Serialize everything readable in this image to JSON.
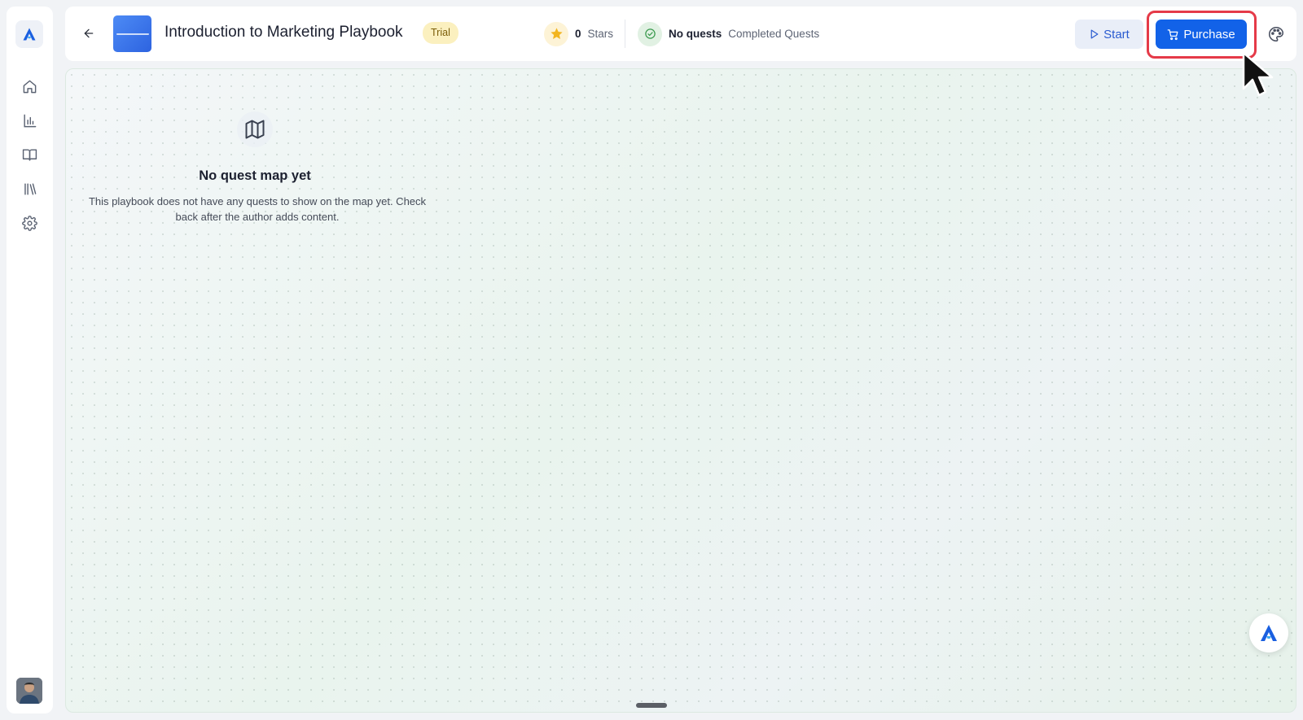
{
  "sidebar": {
    "logo_icon": "brand-logo-icon",
    "items": [
      {
        "icon": "home-icon"
      },
      {
        "icon": "bar-chart-icon"
      },
      {
        "icon": "open-book-icon"
      },
      {
        "icon": "library-icon"
      },
      {
        "icon": "gear-icon"
      }
    ],
    "avatar_icon": "user-avatar"
  },
  "header": {
    "back_icon": "arrow-left-icon",
    "title": "Introduction to Marketing Playbook",
    "badge": "Trial",
    "stars": {
      "value": "0",
      "label": "Stars"
    },
    "quests": {
      "value": "No quests",
      "label": "Completed Quests"
    },
    "start_label": "Start",
    "purchase_label": "Purchase",
    "palette_icon": "palette-icon"
  },
  "empty_state": {
    "icon": "map-icon",
    "title": "No quest map yet",
    "description": "This playbook does not have any quests to show on the map yet. Check back after the author adds content."
  },
  "colors": {
    "accent": "#1262e8",
    "highlight_ring": "#e53a48",
    "badge_bg": "#fbf0bf",
    "star": "#f2b520"
  }
}
